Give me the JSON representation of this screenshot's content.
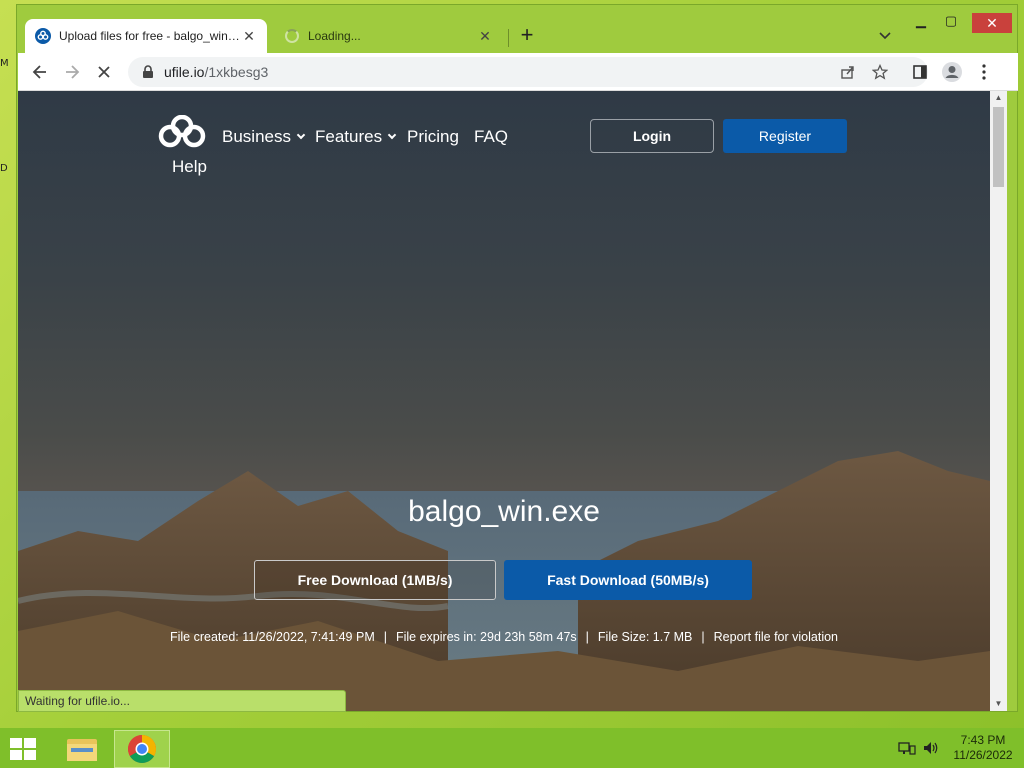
{
  "browser": {
    "tabs": [
      {
        "title": "Upload files for free - balgo_win.exe - ufile.io",
        "state": "active"
      },
      {
        "title": "Loading...",
        "state": "loading"
      }
    ],
    "url_domain": "ufile.io",
    "url_path": "/1xkbesg3",
    "status_text": "Waiting for ufile.io..."
  },
  "site": {
    "nav": {
      "business": "Business",
      "features": "Features",
      "pricing": "Pricing",
      "faq": "FAQ",
      "help": "Help",
      "login": "Login",
      "register": "Register"
    },
    "file": {
      "name": "balgo_win.exe",
      "free_download": "Free Download (1MB/s)",
      "fast_download": "Fast Download (50MB/s)",
      "created": "File created: 11/26/2022, 7:41:49 PM",
      "expires": "File expires in: 29d 23h 58m 47s",
      "size": "File Size: 1.7 MB",
      "report": "Report file for violation",
      "separator": "|"
    },
    "colors": {
      "primary": "#0b5aa8",
      "hero_dark": "#2f3a46"
    }
  },
  "taskbar": {
    "time": "7:43 PM",
    "date": "11/26/2022"
  },
  "desktop_edge": {
    "top": "M",
    "mid": "D"
  }
}
